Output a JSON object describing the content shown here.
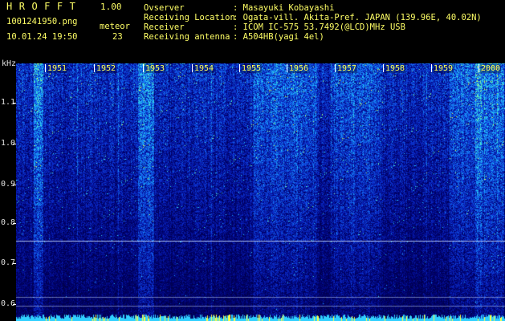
{
  "app": {
    "title": "HROFFT",
    "version": "1.00"
  },
  "file": {
    "name": "1001241950.png",
    "datetime": "10.01.24 19:50"
  },
  "meteor": {
    "label": "meteor",
    "count": "23"
  },
  "info": [
    {
      "label": "Ovserver",
      "value": ": Masayuki Kobayashi"
    },
    {
      "label": "Receiving Location",
      "value": ": Ogata-vill. Akita-Pref. JAPAN (139.96E, 40.02N)"
    },
    {
      "label": "Receiver",
      "value": ": ICOM IC-575 53.7492(@LCD)MHz USB"
    },
    {
      "label": "Receiving antenna",
      "value": ": A504HB(yagi 4el)"
    }
  ],
  "axis": {
    "unit": "kHz",
    "freq_ticks": [
      "1.1",
      "1.0",
      "0.9",
      "0.8",
      "0.7",
      "0.6"
    ],
    "time_ticks": [
      "1951",
      "1952",
      "1953",
      "1954",
      "1955",
      "1956",
      "1957",
      "1958",
      "1959",
      "2000"
    ]
  },
  "colors": {
    "header_text": "#ffff66",
    "background": "#000000",
    "noise_low": "#000060",
    "noise_mid": "#1040d0",
    "noise_high": "#20c0ff",
    "hot": "#ffff40"
  }
}
